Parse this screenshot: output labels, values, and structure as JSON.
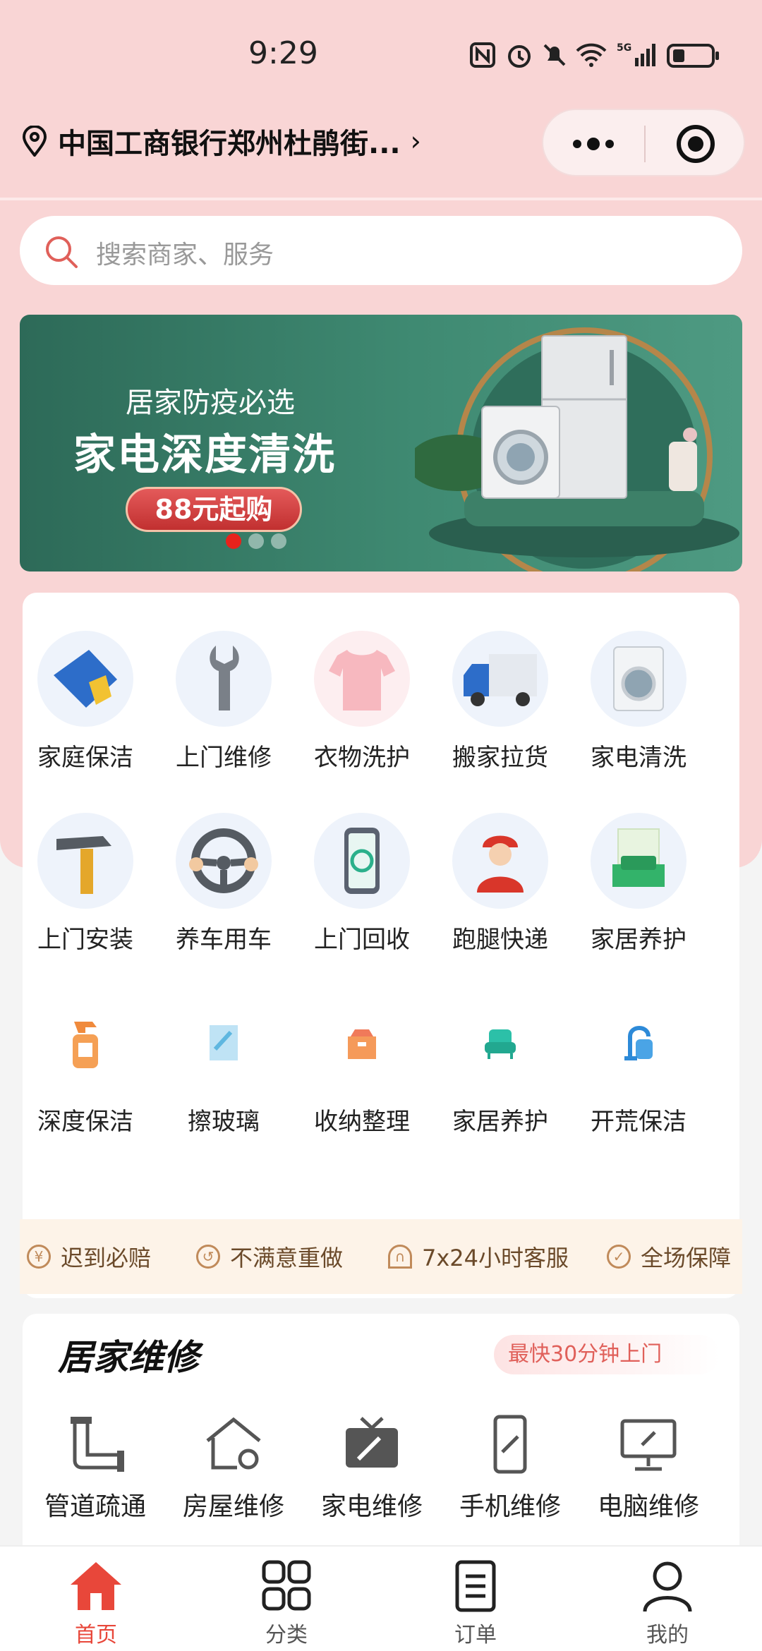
{
  "status_bar": {
    "time": "9:29"
  },
  "header": {
    "location": "中国工商银行郑州杜鹃街...",
    "chevron": "›"
  },
  "search": {
    "placeholder": "搜索商家、服务"
  },
  "banner": {
    "subtitle": "居家防疫必选",
    "title": "家电深度清洗",
    "button": "88元起购",
    "active_slide": 1,
    "slide_count": 3
  },
  "services": [
    {
      "label": "家庭保洁",
      "icon": "cleaning-cloth-icon"
    },
    {
      "label": "上门维修",
      "icon": "wrench-icon"
    },
    {
      "label": "衣物洗护",
      "icon": "tshirt-icon"
    },
    {
      "label": "搬家拉货",
      "icon": "truck-icon"
    },
    {
      "label": "家电清洗",
      "icon": "washing-machine-icon"
    },
    {
      "label": "上门安装",
      "icon": "hammer-icon"
    },
    {
      "label": "养车用车",
      "icon": "steering-wheel-icon"
    },
    {
      "label": "上门回收",
      "icon": "recycle-phone-icon"
    },
    {
      "label": "跑腿快递",
      "icon": "courier-icon"
    },
    {
      "label": "家居养护",
      "icon": "sofa-icon"
    },
    {
      "label": "深度保洁",
      "icon": "spray-bottle-icon"
    },
    {
      "label": "擦玻璃",
      "icon": "window-wiper-icon"
    },
    {
      "label": "收纳整理",
      "icon": "storage-box-icon"
    },
    {
      "label": "家居养护",
      "icon": "armchair-icon"
    },
    {
      "label": "开荒保洁",
      "icon": "vacuum-icon"
    }
  ],
  "guarantees": [
    {
      "label": "迟到必赔",
      "icon": "yen-icon"
    },
    {
      "label": "不满意重做",
      "icon": "redo-icon"
    },
    {
      "label": "7x24小时客服",
      "icon": "headset-icon"
    },
    {
      "label": "全场保障",
      "icon": "check-icon"
    }
  ],
  "repair": {
    "title": "居家维修",
    "tag": "最快30分钟上门",
    "items": [
      {
        "label": "管道疏通",
        "icon": "pipe-icon"
      },
      {
        "label": "房屋维修",
        "icon": "house-gear-icon"
      },
      {
        "label": "家电维修",
        "icon": "tv-repair-icon"
      },
      {
        "label": "手机维修",
        "icon": "phone-repair-icon"
      },
      {
        "label": "电脑维修",
        "icon": "computer-repair-icon"
      }
    ]
  },
  "tabs": [
    {
      "label": "首页",
      "icon": "home-icon",
      "active": true
    },
    {
      "label": "分类",
      "icon": "grid-icon",
      "active": false
    },
    {
      "label": "订单",
      "icon": "order-icon",
      "active": false
    },
    {
      "label": "我的",
      "icon": "user-icon",
      "active": false
    }
  ],
  "colors": {
    "accent": "#e8473a",
    "pink_bg": "#f9d5d5",
    "banner_green": "#3f8a72"
  }
}
